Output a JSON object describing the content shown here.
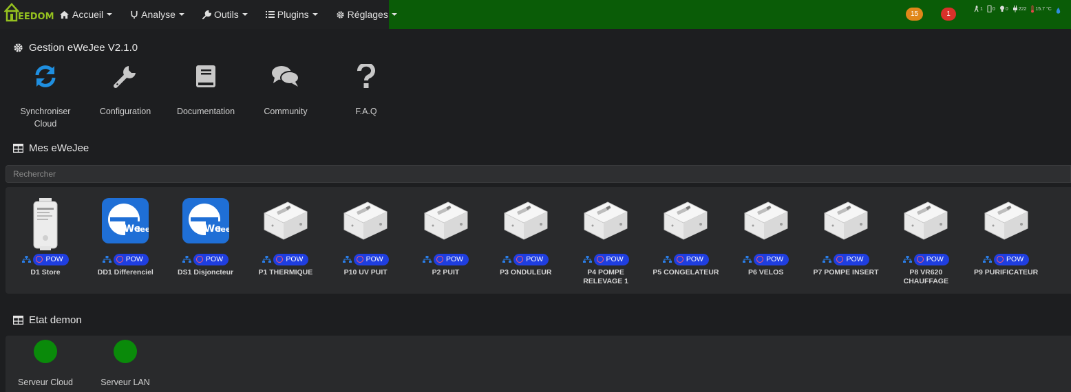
{
  "navbar": {
    "logo_text": "EEDOM",
    "menu": [
      {
        "label": "Accueil",
        "icon": "home-icon"
      },
      {
        "label": "Analyse",
        "icon": "stethoscope-icon"
      },
      {
        "label": "Outils",
        "icon": "wrench-icon"
      },
      {
        "label": "Plugins",
        "icon": "list-icon"
      },
      {
        "label": "Réglages",
        "icon": "gear-icon"
      }
    ],
    "badges": {
      "messages": "15",
      "alerts": "1"
    },
    "status": {
      "motion": "1",
      "door": "0",
      "light": "0",
      "power": "222",
      "temperature": "15.7 °C"
    },
    "green_color": "#0a5c07"
  },
  "management": {
    "title": "Gestion eWeJee V2.1.0",
    "actions": [
      {
        "label_line1": "Synchroniser",
        "label_line2": "Cloud",
        "icon": "sync-icon"
      },
      {
        "label_line1": "Configuration",
        "label_line2": "",
        "icon": "wrench-icon"
      },
      {
        "label_line1": "Documentation",
        "label_line2": "",
        "icon": "book-icon"
      },
      {
        "label_line1": "Community",
        "label_line2": "",
        "icon": "comments-icon"
      },
      {
        "label_line1": "F.A.Q",
        "label_line2": "",
        "icon": "question-icon"
      }
    ]
  },
  "devices_section": {
    "title": "Mes eWeJee",
    "search_placeholder": "Rechercher",
    "tag_label": "POW",
    "tag_color": "#1f3ee0",
    "devices": [
      {
        "name": "D1 Store",
        "image": "sonoff-basic-icon"
      },
      {
        "name": "DD1 Differenciel",
        "image": "ewelink-logo-icon"
      },
      {
        "name": "DS1 Disjoncteur",
        "image": "ewelink-logo-icon"
      },
      {
        "name": "P1 THERMIQUE",
        "image": "sonoff-pow-icon"
      },
      {
        "name": "P10 UV PUIT",
        "image": "sonoff-pow-icon"
      },
      {
        "name": "P2 PUIT",
        "image": "sonoff-pow-icon"
      },
      {
        "name": "P3 ONDULEUR",
        "image": "sonoff-pow-icon"
      },
      {
        "name": "P4 POMPE RELEVAGE 1",
        "image": "sonoff-pow-icon"
      },
      {
        "name": "P5 CONGELATEUR",
        "image": "sonoff-pow-icon"
      },
      {
        "name": "P6 VELOS",
        "image": "sonoff-pow-icon"
      },
      {
        "name": "P7 POMPE INSERT",
        "image": "sonoff-pow-icon"
      },
      {
        "name": "P8 VR620 CHAUFFAGE",
        "image": "sonoff-pow-icon"
      },
      {
        "name": "P9 PURIFICATEUR",
        "image": "sonoff-pow-icon"
      }
    ]
  },
  "demon_section": {
    "title": "Etat demon",
    "items": [
      {
        "label": "Serveur Cloud",
        "state_color": "#0a8a0a"
      },
      {
        "label": "Serveur LAN",
        "state_color": "#0a8a0a"
      }
    ]
  }
}
